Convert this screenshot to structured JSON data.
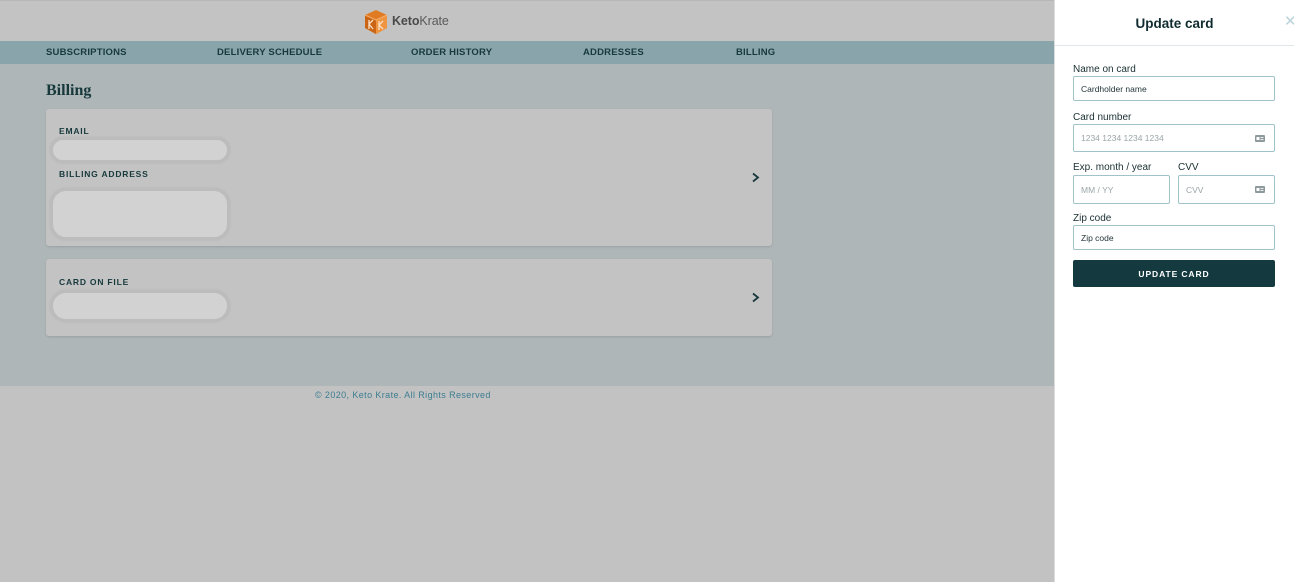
{
  "header": {
    "brand_bold": "Keto",
    "brand_rest": "Krate"
  },
  "nav": {
    "items": [
      {
        "label": "SUBSCRIPTIONS"
      },
      {
        "label": "DELIVERY SCHEDULE"
      },
      {
        "label": "ORDER HISTORY"
      },
      {
        "label": "ADDRESSES"
      },
      {
        "label": "BILLING"
      }
    ]
  },
  "main": {
    "title": "Billing",
    "details_card": {
      "email_label": "EMAIL",
      "billing_address_label": "BILLING ADDRESS"
    },
    "card_on_file": {
      "label": "CARD ON FILE"
    }
  },
  "footer": {
    "text": "© 2020, Keto Krate. All Rights Reserved"
  },
  "panel": {
    "title": "Update card",
    "close_glyph": "✕",
    "name_label": "Name on card",
    "name_placeholder": "Cardholder name",
    "number_label": "Card number",
    "number_placeholder": "1234 1234 1234 1234",
    "exp_label": "Exp. month / year",
    "exp_placeholder": "MM / YY",
    "cvv_label": "CVV",
    "cvv_placeholder": "CVV",
    "zip_label": "Zip code",
    "zip_placeholder": "Zip code",
    "submit_label": "UPDATE CARD"
  },
  "icons": {
    "logo": "box-logo-icon",
    "chevron": "chevron-right-icon",
    "card": "credit-card-icon",
    "close": "close-icon"
  },
  "colors": {
    "accent": "#143a3f",
    "nav_bg": "#89a5ab",
    "input_border": "#9fc3c9",
    "logo_orange": "#e07b24"
  }
}
